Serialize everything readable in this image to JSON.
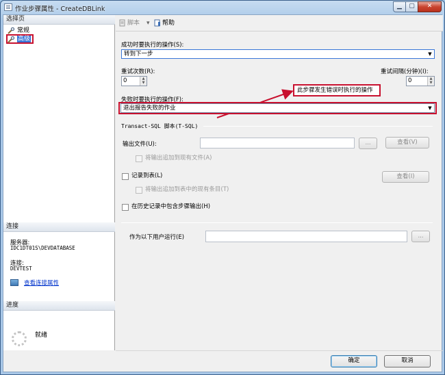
{
  "window": {
    "title": "作业步骤属性 - CreateDBLink",
    "controls": {
      "minimize": "▁",
      "maximize": "▢",
      "close": "✕"
    }
  },
  "left_pane": {
    "select_page_header": "选择页",
    "nav_items": [
      {
        "label": "常规",
        "icon": "wrench-icon"
      },
      {
        "label": "高级",
        "icon": "wrench-icon",
        "selected": true
      }
    ],
    "connection_header": "连接",
    "server_label": "服务器:",
    "server_value": "IDC1DT01S\\DEVDATABASE",
    "connection_label": "连接:",
    "connection_value": "DEVTEST",
    "view_properties_link": "查看连接属性",
    "progress_header": "进度",
    "progress_status": "就绪"
  },
  "toolbar": {
    "script_label": "脚本",
    "script_dropdown": "▾",
    "help_label": "帮助"
  },
  "form": {
    "on_success_label": "成功时要执行的操作(S):",
    "on_success_value": "转到下一步",
    "retry_attempts_label": "重试次数(R):",
    "retry_attempts_value": "0",
    "retry_interval_label": "重试间隔(分钟)(I):",
    "retry_interval_value": "0",
    "on_failure_label": "失败时要执行的操作(F):",
    "on_failure_value": "退出报告失败的作业",
    "callout_text": "此步骤发生错误时执行的操作",
    "tsql_section": "Transact-SQL 脚本(T-SQL)",
    "output_file_label": "输出文件(U):",
    "browse_button": "...",
    "view_button_1": "查看(V)",
    "append_output_file": "将输出追加到现有文件(A)",
    "log_to_table": "记录到表(L)",
    "view_button_2": "查看(I)",
    "append_output_table": "将输出追加到表中的现有条目(T)",
    "include_history": "在历史记录中包含步骤输出(H)",
    "run_as_label": "作为以下用户运行(E)",
    "run_as_browse": "..."
  },
  "footer": {
    "ok_button": "确定",
    "cancel_button": "取消"
  },
  "icons": {
    "combo_arrow": "▼",
    "spin_up": "▲",
    "spin_down": "▼"
  },
  "colors": {
    "highlight_red": "#c8102e",
    "selection_blue": "#3875d7",
    "link_blue": "#0033cc"
  }
}
